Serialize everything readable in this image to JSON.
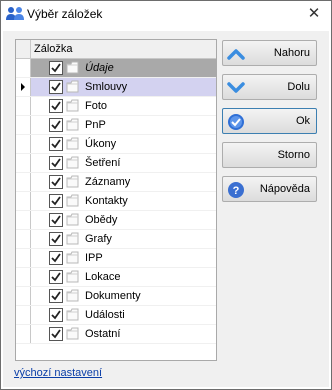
{
  "window": {
    "title": "Výběr záložek",
    "close_glyph": "✕"
  },
  "grid": {
    "column_header": "Záložka",
    "rows": [
      {
        "label": "Údaje",
        "checked": true,
        "state": "current"
      },
      {
        "label": "Smlouvy",
        "checked": true,
        "state": "selected"
      },
      {
        "label": "Foto",
        "checked": true,
        "state": ""
      },
      {
        "label": "PnP",
        "checked": true,
        "state": ""
      },
      {
        "label": "Úkony",
        "checked": true,
        "state": ""
      },
      {
        "label": "Šetření",
        "checked": true,
        "state": ""
      },
      {
        "label": "Záznamy",
        "checked": true,
        "state": ""
      },
      {
        "label": "Kontakty",
        "checked": true,
        "state": ""
      },
      {
        "label": "Obědy",
        "checked": true,
        "state": ""
      },
      {
        "label": "Grafy",
        "checked": true,
        "state": ""
      },
      {
        "label": "IPP",
        "checked": true,
        "state": ""
      },
      {
        "label": "Lokace",
        "checked": true,
        "state": ""
      },
      {
        "label": "Dokumenty",
        "checked": true,
        "state": ""
      },
      {
        "label": "Události",
        "checked": true,
        "state": ""
      },
      {
        "label": "Ostatní",
        "checked": true,
        "state": ""
      }
    ]
  },
  "buttons": {
    "up": {
      "label": "Nahoru",
      "icon": "chevron-up-icon"
    },
    "down": {
      "label": "Dolu",
      "icon": "chevron-down-icon"
    },
    "ok": {
      "label": "Ok",
      "icon": "check-circle-icon"
    },
    "cancel": {
      "label": "Storno"
    },
    "help": {
      "label": "Nápověda",
      "icon": "help-icon"
    }
  },
  "footer": {
    "reset_link": "výchozí nastavení"
  },
  "colors": {
    "selected_row": "#d3d2f0",
    "current_row": "#a9a9a9",
    "accent_blue": "#3a8de0",
    "link": "#0a3ea8"
  }
}
